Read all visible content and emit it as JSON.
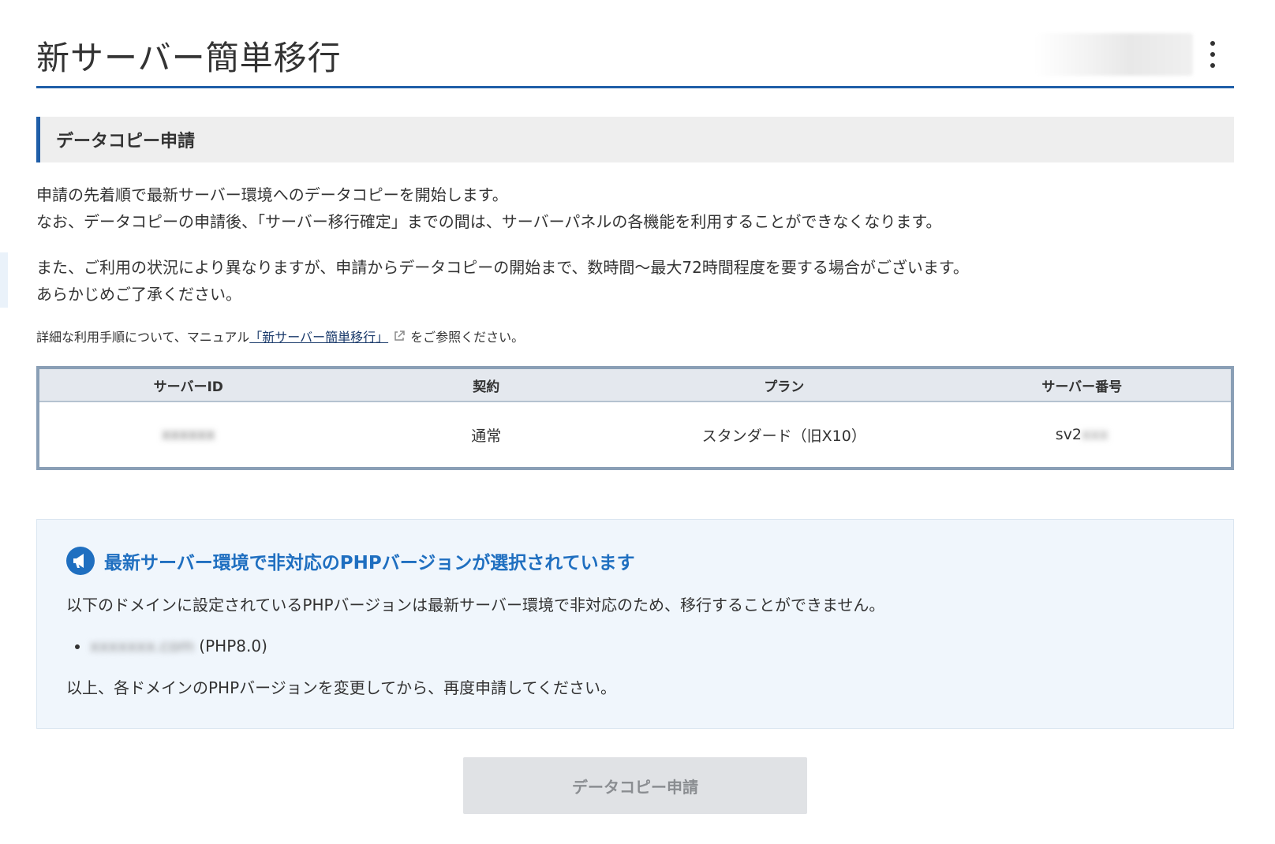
{
  "header": {
    "title": "新サーバー簡単移行",
    "account_label": ""
  },
  "section": {
    "title": "データコピー申請"
  },
  "description": {
    "line1": "申請の先着順で最新サーバー環境へのデータコピーを開始します。",
    "line2": "なお、データコピーの申請後、「サーバー移行確定」までの間は、サーバーパネルの各機能を利用することができなくなります。",
    "line3": "また、ご利用の状況により異なりますが、申請からデータコピーの開始まで、数時間～最大72時間程度を要する場合がございます。",
    "line4": "あらかじめご了承ください。"
  },
  "manual": {
    "prefix": "詳細な利用手順について、マニュアル",
    "link": "「新サーバー簡単移行」",
    "suffix": "をご参照ください。"
  },
  "table": {
    "headers": [
      "サーバーID",
      "契約",
      "プラン",
      "サーバー番号"
    ],
    "row": {
      "server_id": "xxxxxx",
      "contract": "通常",
      "plan": "スタンダード（旧X10）",
      "server_number_prefix": "sv2",
      "server_number_rest": "xxx"
    }
  },
  "warning": {
    "title": "最新サーバー環境で非対応のPHPバージョンが選択されています",
    "text": "以下のドメインに設定されているPHPバージョンは最新サーバー環境で非対応のため、移行することができません。",
    "domains": [
      {
        "domain": "xxxxxxx.com",
        "php": "(PHP8.0)"
      }
    ],
    "footer": "以上、各ドメインのPHPバージョンを変更してから、再度申請してください。"
  },
  "button": {
    "label": "データコピー申請",
    "enabled": false
  },
  "colors": {
    "accent": "#1f5ea8",
    "warning_title": "#1f6fc0",
    "warning_bg": "#f0f6fc",
    "disabled_button": "#e0e2e5"
  }
}
